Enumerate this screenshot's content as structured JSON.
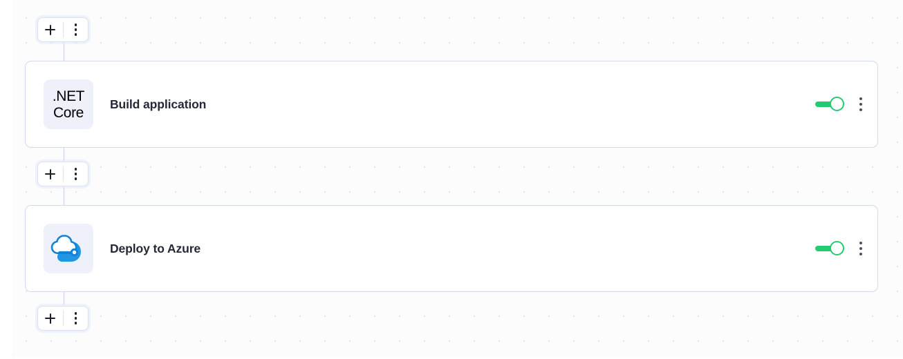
{
  "canvas": {
    "background_color": "#fcfcfd",
    "dot_color": "#dfe4f5",
    "accent_border_color": "#cfdaf3"
  },
  "add_buttons": [
    {
      "plus_label": "+",
      "menu_label": "⋮",
      "name": "add-step-top"
    },
    {
      "plus_label": "+",
      "menu_label": "⋮",
      "name": "add-step-middle"
    },
    {
      "plus_label": "+",
      "menu_label": "⋮",
      "name": "add-step-bottom"
    }
  ],
  "steps": [
    {
      "title": "Build application",
      "icon": "dotnet-core-icon",
      "icon_text_line1": ".NET",
      "icon_text_line2": "Core",
      "enabled": true,
      "toggle_color": "#25cb71",
      "menu_label": "⋮"
    },
    {
      "title": "Deploy to Azure",
      "icon": "azure-cloud-icon",
      "icon_text_line1": "",
      "icon_text_line2": "",
      "enabled": true,
      "toggle_color": "#25cb71",
      "menu_label": "⋮"
    }
  ]
}
